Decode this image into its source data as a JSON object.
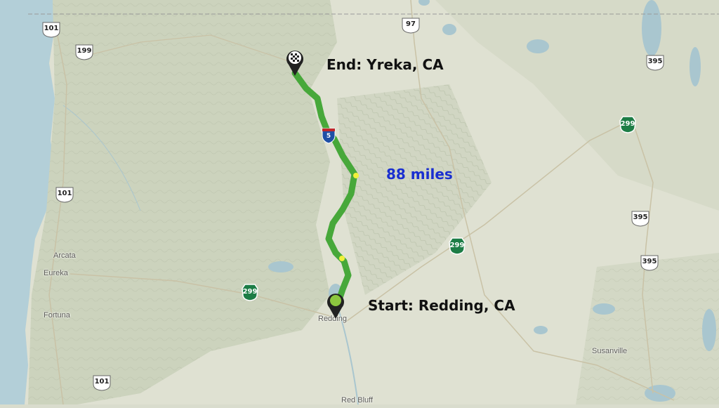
{
  "map": {
    "start_label": "Start: Redding, CA",
    "end_label": "End: Yreka, CA",
    "distance_label": "88 miles",
    "colors": {
      "route": "#47a83a",
      "traffic_marker": "#f0f03a",
      "distance_text": "#1a2fd0",
      "ocean": "#b3cfd8",
      "land": "#d9dccd",
      "forest": "#c4cfb4"
    },
    "places": [
      "Arcata",
      "Eureka",
      "Fortuna",
      "Redding",
      "Red Bluff",
      "Susanville"
    ],
    "us_routes": [
      "101",
      "199",
      "101",
      "101",
      "97",
      "395",
      "395",
      "395"
    ],
    "ca_routes": [
      "299",
      "299",
      "299"
    ],
    "interstates": [
      "5"
    ],
    "markers": {
      "start_icon": "green-circle-pin-icon",
      "end_icon": "checkered-flag-pin-icon"
    }
  }
}
